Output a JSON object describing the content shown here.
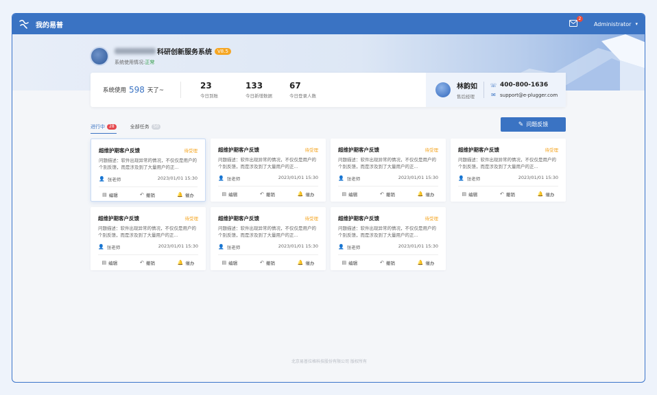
{
  "header": {
    "app_title": "我的易普",
    "mail_count": "2",
    "user": "Administrator"
  },
  "system": {
    "name": "科研创新服务系统",
    "version": "V8.5",
    "status_label": "系统使用情况:",
    "status_value": "正常"
  },
  "stats": {
    "usage_label": "系统使用",
    "usage_days": "598",
    "usage_unit": "天了~",
    "items": [
      {
        "value": "23",
        "label": "今日到账"
      },
      {
        "value": "133",
        "label": "今日新增数据"
      },
      {
        "value": "67",
        "label": "今日登录人数"
      }
    ]
  },
  "contact": {
    "name": "林韵如",
    "role": "售后经理",
    "phone": "400-800-1636",
    "email": "support@e-plugger.com"
  },
  "tabs": [
    {
      "label": "进行中",
      "count": "28"
    },
    {
      "label": "全部任务",
      "count": "50"
    }
  ],
  "feedback_button": "问题反馈",
  "cards": [
    {
      "title": "超维护期客户反馈",
      "status": "待受理",
      "desc": "问题描述：软件出现异常的情况，不仅仅是用户的个别反馈，而是涉及到了大量用户的正...",
      "person": "张老师",
      "date": "2023/01/01  15:30",
      "actions": [
        "编辑",
        "撤销",
        "催办"
      ]
    },
    {
      "title": "超维护期客户反馈",
      "status": "待受理",
      "desc": "问题描述：软件出现异常的情况，不仅仅是用户的个别反馈，而是涉及到了大量用户的正...",
      "person": "张老师",
      "date": "2023/01/01  15:30",
      "actions": [
        "编辑",
        "撤销",
        "催办"
      ]
    },
    {
      "title": "超维护期客户反馈",
      "status": "待受理",
      "desc": "问题描述：软件出现异常的情况，不仅仅是用户的个别反馈，而是涉及到了大量用户的正...",
      "person": "张老师",
      "date": "2023/01/01  15:30",
      "actions": [
        "编辑",
        "撤销",
        "催办"
      ]
    },
    {
      "title": "超维护期客户反馈",
      "status": "待受理",
      "desc": "问题描述：软件出现异常的情况，不仅仅是用户的个别反馈，而是涉及到了大量用户的正...",
      "person": "张老师",
      "date": "2023/01/01  15:30",
      "actions": [
        "编辑",
        "撤销",
        "催办"
      ]
    },
    {
      "title": "超维护期客户反馈",
      "status": "待受理",
      "desc": "问题描述：软件出现异常的情况，不仅仅是用户的个别反馈，而是涉及到了大量用户的正...",
      "person": "张老师",
      "date": "2023/01/01  15:30",
      "actions": [
        "编辑",
        "撤销",
        "催办"
      ]
    },
    {
      "title": "超维护期客户反馈",
      "status": "待受理",
      "desc": "问题描述：软件出现异常的情况，不仅仅是用户的个别反馈，而是涉及到了大量用户的正...",
      "person": "张老师",
      "date": "2023/01/01  15:30",
      "actions": [
        "编辑",
        "撤销",
        "催办"
      ]
    },
    {
      "title": "超维护期客户反馈",
      "status": "待受理",
      "desc": "问题描述：软件出现异常的情况，不仅仅是用户的个别反馈，而是涉及到了大量用户的正...",
      "person": "张老师",
      "date": "2023/01/01  15:30",
      "actions": [
        "编辑",
        "撤销",
        "催办"
      ]
    }
  ],
  "footer": "北京易普拉格科技股份有限公司 版权所有"
}
